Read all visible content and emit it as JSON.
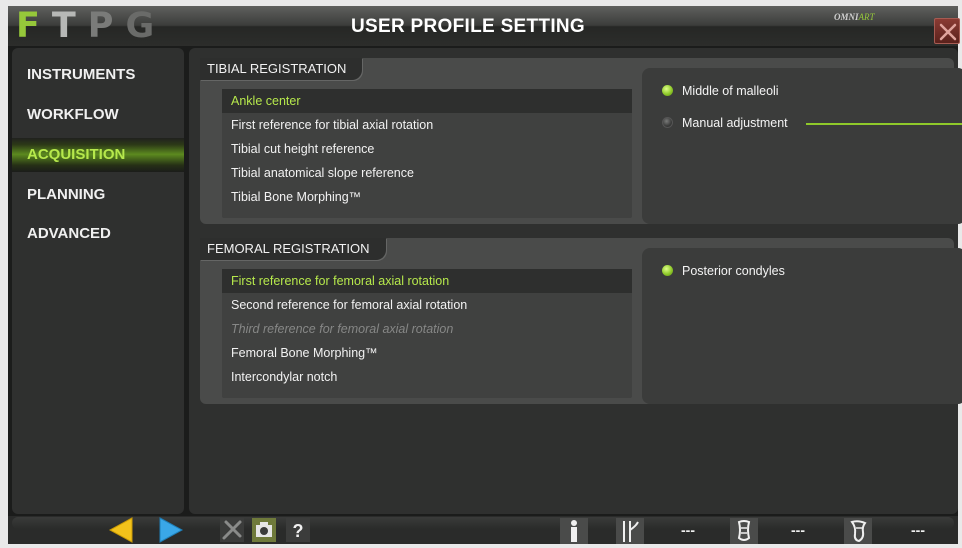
{
  "app": {
    "logo_letters": [
      "F",
      "T",
      "P",
      "G"
    ],
    "title": "USER PROFILE SETTING",
    "brand": {
      "omni": "OMNI",
      "art": "ART"
    }
  },
  "sidebar": {
    "items": [
      {
        "label": "INSTRUMENTS",
        "active": false
      },
      {
        "label": "WORKFLOW",
        "active": false
      },
      {
        "label": "ACQUISITION",
        "active": true
      },
      {
        "label": "PLANNING",
        "active": false
      },
      {
        "label": "ADVANCED",
        "active": false
      }
    ]
  },
  "tibial": {
    "heading": "TIBIAL REGISTRATION",
    "items": [
      {
        "label": "Ankle center",
        "state": "selected"
      },
      {
        "label": "First reference for tibial axial rotation",
        "state": "normal"
      },
      {
        "label": "Tibial cut height reference",
        "state": "normal"
      },
      {
        "label": "Tibial anatomical slope reference",
        "state": "normal"
      },
      {
        "label": "Tibial Bone Morphing™",
        "state": "normal"
      }
    ],
    "options": [
      {
        "label": "Middle of malleoli",
        "checked": true
      },
      {
        "label": "Manual adjustment",
        "checked": false
      }
    ]
  },
  "femoral": {
    "heading": "FEMORAL REGISTRATION",
    "items": [
      {
        "label": "First reference for femoral axial rotation",
        "state": "selected"
      },
      {
        "label": "Second reference for femoral axial rotation",
        "state": "normal"
      },
      {
        "label": "Third reference for femoral axial rotation",
        "state": "disabled"
      },
      {
        "label": "Femoral Bone Morphing™",
        "state": "normal"
      },
      {
        "label": "Intercondylar notch",
        "state": "normal"
      }
    ],
    "options": [
      {
        "label": "Posterior condyles",
        "checked": true
      }
    ]
  },
  "bottombar": {
    "icons": [
      "back-arrow-icon",
      "forward-arrow-icon",
      "tools-icon",
      "camera-icon",
      "help-icon",
      "person-icon",
      "leg-icon",
      "femur-icon",
      "tibia-icon"
    ],
    "values": [
      "---",
      "---",
      "---"
    ]
  },
  "colors": {
    "accent": "#96c83a",
    "selected_text": "#b6e84c",
    "panel": "#4a4b4a",
    "background": "#1b1c1b"
  }
}
